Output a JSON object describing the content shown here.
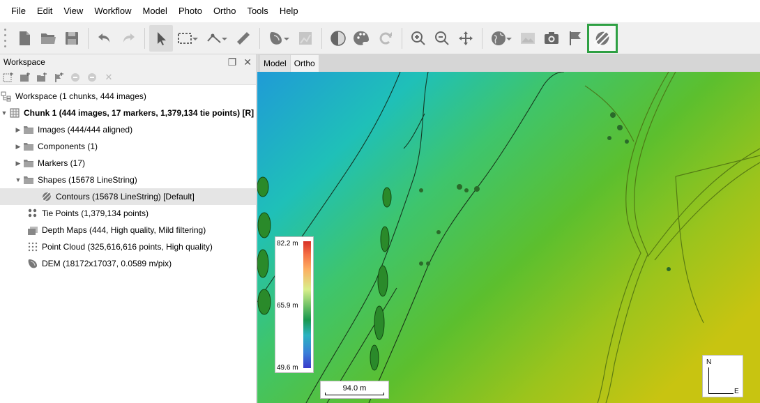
{
  "menu": [
    "File",
    "Edit",
    "View",
    "Workflow",
    "Model",
    "Photo",
    "Ortho",
    "Tools",
    "Help"
  ],
  "toolbar": {
    "buttons": [
      "new-document-icon",
      "open-folder-icon",
      "save-icon",
      "undo-icon",
      "redo-icon",
      "pointer-icon",
      "rectangle-selection-icon",
      "ruler-line-icon",
      "measure-ruler-icon",
      "dem-shape-icon",
      "ortho-icon",
      "shading-icon",
      "palette-icon",
      "refresh-icon",
      "zoom-in-icon",
      "zoom-out-icon",
      "move-icon",
      "globe-icon",
      "image-icon",
      "camera-icon",
      "flag-icon",
      "contour-icon"
    ],
    "highlight_color": "#2ea043"
  },
  "workspace": {
    "title": "Workspace",
    "tree": [
      {
        "label": "Workspace (1 chunks, 444 images)",
        "icon": "workspace-icon",
        "bold": false
      },
      {
        "label": "Chunk 1 (444 images, 17 markers, 1,379,134 tie points) [R]",
        "icon": "chunk-icon",
        "bold": true
      },
      {
        "label": "Images (444/444 aligned)",
        "icon": "folder-icon"
      },
      {
        "label": "Components (1)",
        "icon": "folder-icon"
      },
      {
        "label": "Markers (17)",
        "icon": "folder-icon"
      },
      {
        "label": "Shapes (15678 LineString)",
        "icon": "folder-icon"
      },
      {
        "label": "Contours (15678 LineString) [Default]",
        "icon": "contours-icon"
      },
      {
        "label": "Tie Points (1,379,134 points)",
        "icon": "tie-points-icon"
      },
      {
        "label": "Depth Maps (444, High quality, Mild filtering)",
        "icon": "depth-maps-icon"
      },
      {
        "label": "Point Cloud (325,616,616 points, High quality)",
        "icon": "point-cloud-icon"
      },
      {
        "label": "DEM (18172x17037, 0.0589 m/pix)",
        "icon": "dem-icon"
      }
    ]
  },
  "view": {
    "tabs": [
      "Model",
      "Ortho"
    ],
    "active_tab": "Ortho",
    "legend": {
      "max": "82.2 m",
      "mid": "65.9 m",
      "min": "49.6 m"
    },
    "scale": "94.0 m",
    "compass": {
      "north": "N",
      "east": "E"
    }
  }
}
